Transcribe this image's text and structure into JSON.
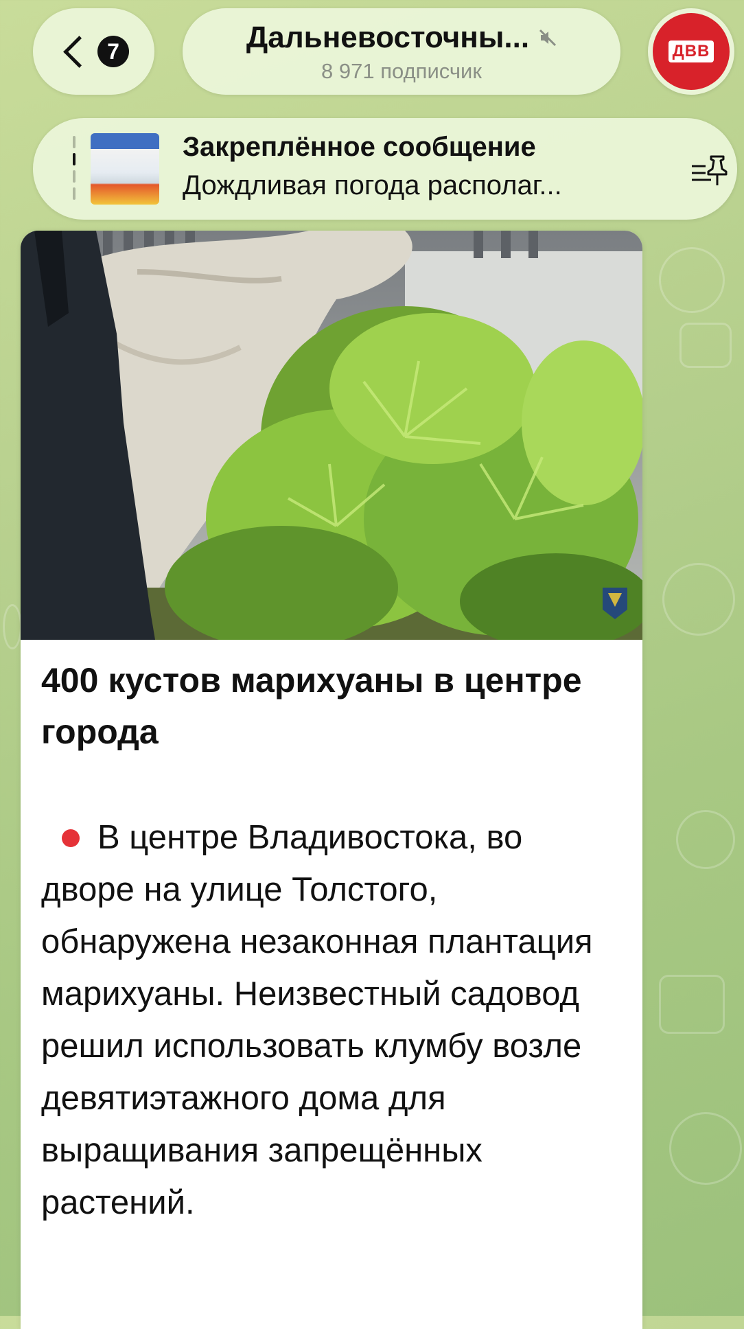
{
  "header": {
    "unread_count": "7",
    "channel_title": "Дальневосточны...",
    "subscribers": "8 971 подписчик",
    "avatar_logo": "ДВВ"
  },
  "pinned": {
    "label": "Закреплённое сообщение",
    "preview": "Дождливая погода располаг..."
  },
  "post": {
    "title": "400 кустов марихуаны в центре города",
    "body": "В центре Владивостока, во дворе на улице Толстого, обнаружена незаконная плантация марихуаны. Неизвестный садовод решил использовать клумбу возле девятиэтажного дома для выращивания запрещённых растений."
  },
  "colors": {
    "accent_red": "#e53238",
    "avatar_red": "#d8222a"
  },
  "icons": {
    "back": "chevron-left-icon",
    "mute": "muted-speaker-icon",
    "pinned_list": "pin-list-icon"
  }
}
